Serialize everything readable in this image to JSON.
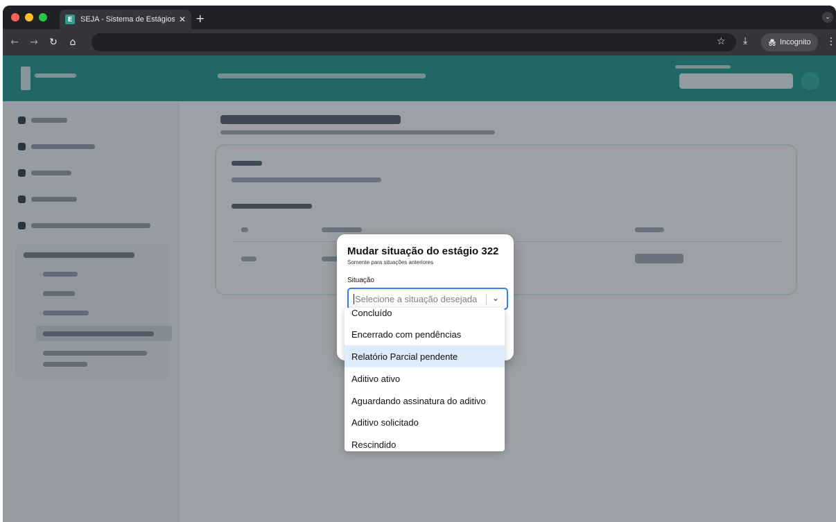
{
  "browser": {
    "tab_title": "SEJA - Sistema de Estágios e",
    "tab_close": "✕",
    "new_tab": "+",
    "favicon_letter": "E",
    "incognito_label": "Incognito",
    "icons": [
      "back-icon",
      "forward-icon",
      "reload-icon",
      "home-icon",
      "star-icon",
      "download-icon",
      "incognito-icon",
      "menu-icon"
    ]
  },
  "modal": {
    "title": "Mudar situação do estágio 322",
    "subtitle": "Somente para situações anteriores",
    "field_label": "Situação",
    "placeholder": "Selecione a situação desejada"
  },
  "dropdown": {
    "options": [
      "Concluído",
      "Encerrado com pendências",
      "Relatório Parcial pendente",
      "Aditivo ativo",
      "Aguardando assinatura do aditivo",
      "Aditivo solicitado",
      "Rescindido"
    ],
    "highlighted_index": 2
  },
  "colors": {
    "appbar": "#2a9d8f",
    "select_border": "#2f7fe8",
    "highlight": "#deebfb"
  }
}
